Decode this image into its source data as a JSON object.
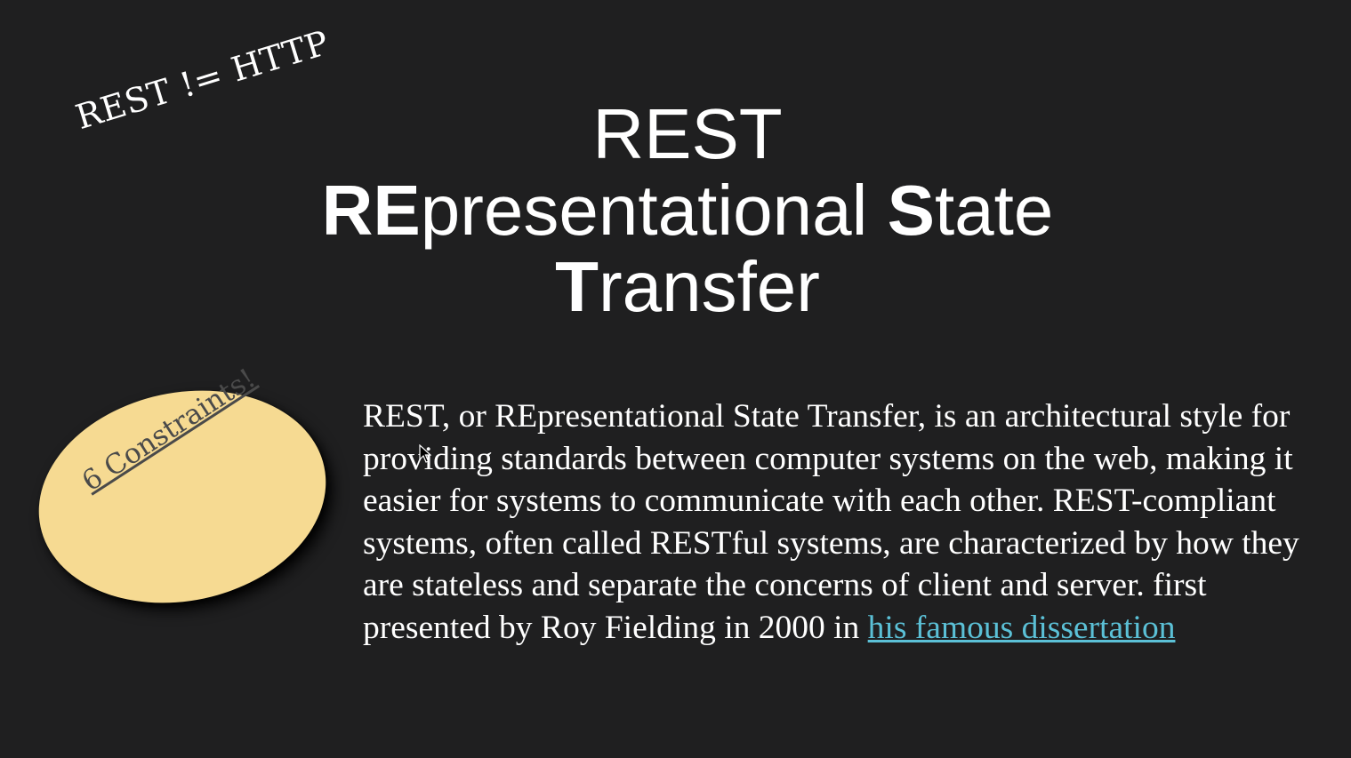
{
  "side_note": "REST != HTTP",
  "title": {
    "line1": "REST",
    "line2_bold_a": "RE",
    "line2_rest_a": "presentational ",
    "line2_bold_b": "S",
    "line2_rest_b": "tate",
    "line3_bold": "T",
    "line3_rest": "ransfer"
  },
  "callout": {
    "label": "6 Constraints!",
    "fill_color": "#f6da92"
  },
  "body": {
    "text": "REST, or REpresentational State Transfer, is an architectural style for providing standards between computer systems on the web, making it easier for systems to communicate with each other. REST-compliant systems, often called RESTful systems, are characterized by how they are stateless and separate the concerns of client and server.  first presented by Roy Fielding in 2000 in ",
    "link_text": "his famous dissertation",
    "link_color": "#5bc0d6"
  },
  "icons": {
    "cursor": "mouse-pointer-icon"
  }
}
